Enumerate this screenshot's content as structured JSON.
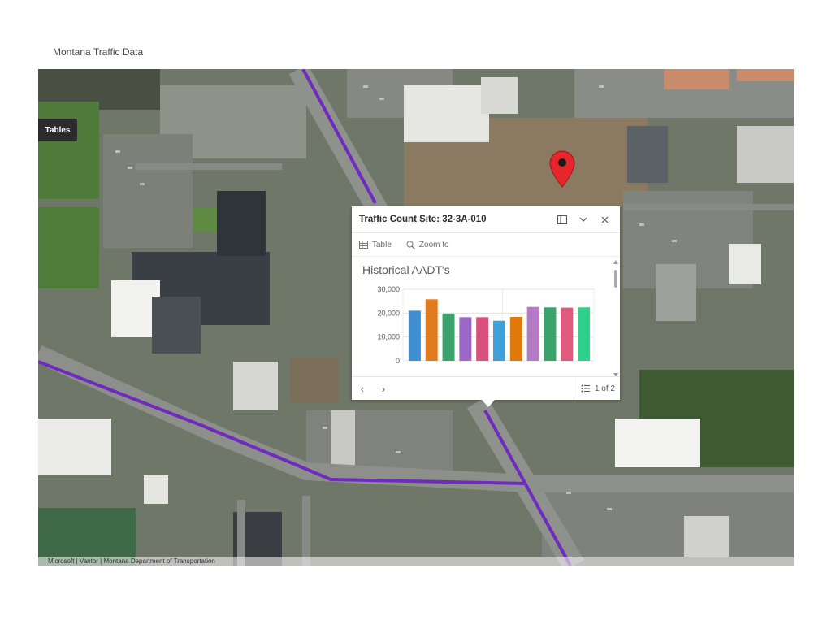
{
  "page": {
    "title": "Montana Traffic Data"
  },
  "map": {
    "tables_button": "Tables",
    "attribution": "Microsoft | Vantor | Montana Department of Transportation"
  },
  "popup": {
    "title": "Traffic Count Site: 32-3A-010",
    "actions": {
      "table": "Table",
      "zoom": "Zoom to"
    },
    "pager": "1 of 2"
  },
  "chart_data": {
    "type": "bar",
    "title": "Historical AADT's",
    "yticks": [
      "30,000",
      "20,000",
      "10,000",
      "0"
    ],
    "ylim": [
      0,
      30000
    ],
    "values": [
      21000,
      25800,
      19800,
      18300,
      18300,
      16800,
      18400,
      22600,
      22400,
      22300,
      22400
    ],
    "colors": [
      "#3f8fd2",
      "#e07a1f",
      "#3aa26b",
      "#9b68c7",
      "#d9507a",
      "#3f9fd8",
      "#e07a0b",
      "#b57ac6",
      "#3aa26b",
      "#e05a7d",
      "#2fd18a"
    ]
  }
}
